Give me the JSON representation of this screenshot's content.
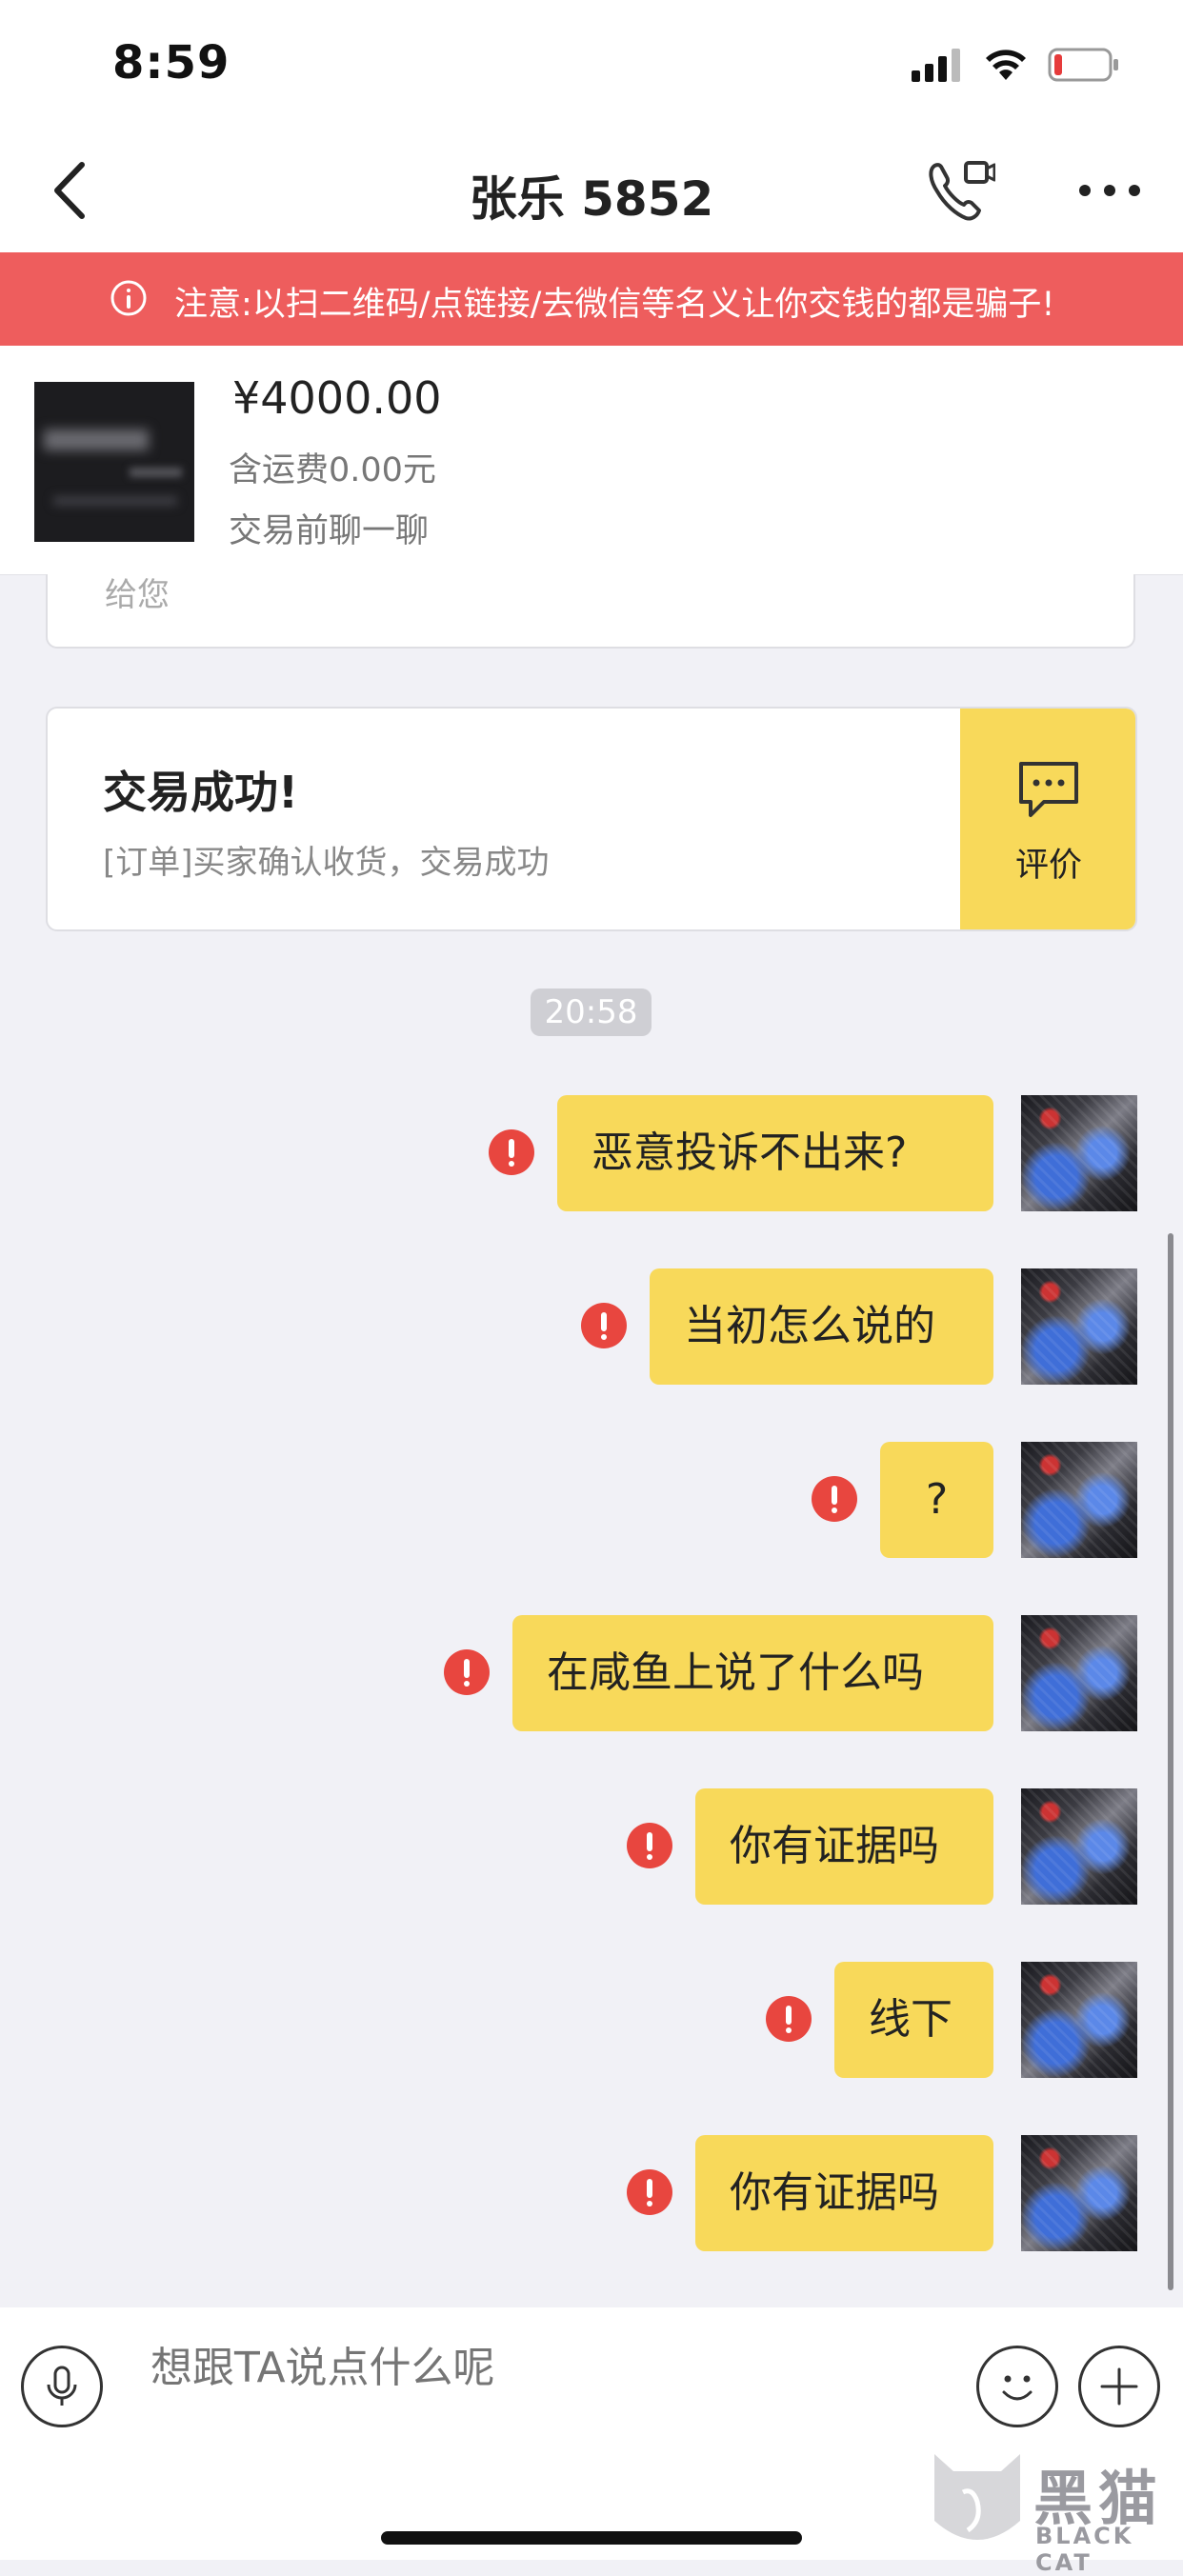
{
  "status_bar": {
    "time": "8:59"
  },
  "header": {
    "title": "张乐 5852"
  },
  "warning": {
    "text": "注意:以扫二维码/点链接/去微信等名义让你交钱的都是骗子!"
  },
  "product": {
    "price": "¥4000.00",
    "shipping": "含运费0.00元",
    "chat_before": "交易前聊一聊"
  },
  "prev_card": {
    "partial_text": "给您"
  },
  "order_card": {
    "title": "交易成功!",
    "description": "[订单]买家确认收货，交易成功",
    "rate_label": "评价"
  },
  "timestamp": "20:58",
  "messages": [
    {
      "text": "恶意投诉不出来?",
      "status": "failed"
    },
    {
      "text": "当初怎么说的",
      "status": "failed"
    },
    {
      "text": "?",
      "status": "failed"
    },
    {
      "text": "在咸鱼上说了什么吗",
      "status": "failed"
    },
    {
      "text": "你有证据吗",
      "status": "failed"
    },
    {
      "text": "线下",
      "status": "failed"
    },
    {
      "text": "你有证据吗",
      "status": "failed"
    }
  ],
  "input": {
    "placeholder": "想跟TA说点什么呢"
  },
  "watermark": {
    "cn": "黑猫",
    "en": "BLACK CAT"
  },
  "colors": {
    "warning_bg": "#ee5d5d",
    "bubble_bg": "#f8d95a",
    "error": "#e8463f"
  }
}
